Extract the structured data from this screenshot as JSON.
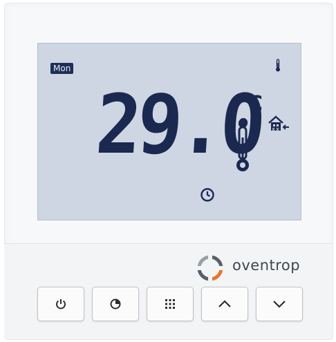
{
  "display": {
    "day": "Mon",
    "temperature": "29.0",
    "unit": "°C"
  },
  "brand": {
    "name": "oventrop"
  },
  "icons": {
    "small_thermometer": "thermometer-icon",
    "large_thermometer": "thermometer-icon",
    "house": "house-window-heating-icon",
    "clock": "clock-icon",
    "logo": "oventrop-logo-icon"
  },
  "buttons": [
    {
      "id": "power",
      "icon": "power-icon"
    },
    {
      "id": "clock",
      "icon": "timer-icon"
    },
    {
      "id": "menu",
      "icon": "grid-menu-icon"
    },
    {
      "id": "up",
      "icon": "chevron-up-icon"
    },
    {
      "id": "down",
      "icon": "chevron-down-icon"
    }
  ],
  "colors": {
    "lcd_background": "#cdd6e2",
    "lcd_segments": "#1b2850",
    "device_body": "#f7f8f9",
    "logo_orange": "#e8762d",
    "logo_gray": "#5a6068"
  }
}
